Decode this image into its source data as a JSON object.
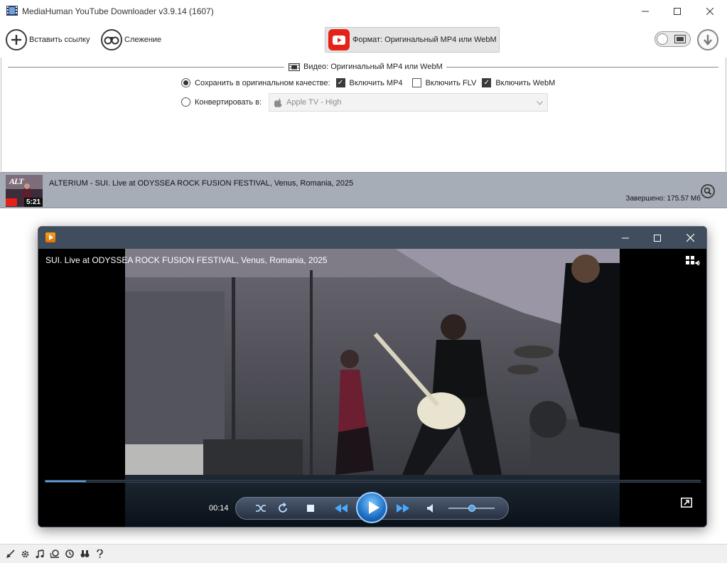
{
  "window": {
    "title": "MediaHuman YouTube Downloader v3.9.14 (1607)"
  },
  "toolbar": {
    "paste_link_label": "Вставить ссылку",
    "tracking_label": "Слежение",
    "format_label": "Формат: Оригинальный MP4 или WebM"
  },
  "settings": {
    "legend": "Видео: Оригинальный MP4 или WebM",
    "save_original_label": "Сохранить в оригинальном качестве:",
    "include_mp4_label": "Включить MP4",
    "include_mp4_checked": true,
    "include_flv_label": "Включить FLV",
    "include_flv_checked": false,
    "include_webm_label": "Включить WebM",
    "include_webm_checked": true,
    "convert_label": "Конвертировать в:",
    "convert_value": "Apple TV - High"
  },
  "download": {
    "thumb_duration": "5:21",
    "thumb_logo_text": "ALT",
    "title": "ALTERIUM  -  SUI. Live at ODYSSEA ROCK FUSION FESTIVAL, Venus, Romania, 2025",
    "status": "Завершено: 175.57 Мб"
  },
  "player": {
    "video_title": "SUI. Live at ODYSSEA ROCK FUSION FESTIVAL, Venus, Romania, 2025",
    "current_time": "00:14",
    "progress": 0.062,
    "volume": 0.5
  },
  "colors": {
    "youtube_red": "#e62117",
    "list_row_bg": "#a7adb7",
    "player_chrome": "#404d5c",
    "progress_blue": "#5aa2e2"
  }
}
